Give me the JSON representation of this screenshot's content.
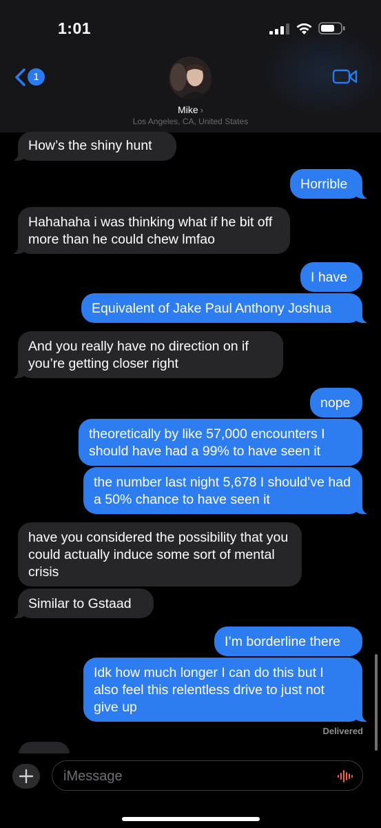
{
  "status_bar": {
    "time": "1:01",
    "icons": [
      "signal-icon",
      "wifi-icon",
      "battery-icon"
    ]
  },
  "header": {
    "back_badge_count": "1",
    "contact_name": "Mike",
    "contact_location": "Los Angeles, CA, United States",
    "icons": [
      "back-chevron-icon",
      "video-camera-icon"
    ]
  },
  "messages": [
    {
      "from": "them",
      "text": "How’s the shiny hunt"
    },
    {
      "from": "me",
      "text": "Horrible"
    },
    {
      "from": "them",
      "text": "Hahahaha i was thinking what if he bit off more than he could chew lmfao"
    },
    {
      "from": "me",
      "text": "I have"
    },
    {
      "from": "me",
      "text": "Equivalent of Jake Paul Anthony Joshua"
    },
    {
      "from": "them",
      "text": "And you really have no direction on if you’re getting closer right"
    },
    {
      "from": "me",
      "text": "nope"
    },
    {
      "from": "me",
      "text": "theoretically by like 57,000 encounters I should have had a 99% to have seen it"
    },
    {
      "from": "me",
      "text": "the number last night 5,678 I should’ve had a 50% chance to have seen it"
    },
    {
      "from": "them",
      "text": "have you considered the possibility that you could actually induce some sort of mental crisis"
    },
    {
      "from": "them",
      "text": "Similar to Gstaad"
    },
    {
      "from": "me",
      "text": "I’m borderline there"
    },
    {
      "from": "me",
      "text": "Idk how much longer I can do this but I also feel this relentless drive to just not give up"
    }
  ],
  "delivery_status": "Delivered",
  "input": {
    "placeholder": "iMessage",
    "value": "",
    "plus_label": "+"
  },
  "colors": {
    "sent_bubble": "#2d7df0",
    "received_bubble": "#262629",
    "accent": "#2b7bf0",
    "audio_icon": "#ff5a4f"
  }
}
